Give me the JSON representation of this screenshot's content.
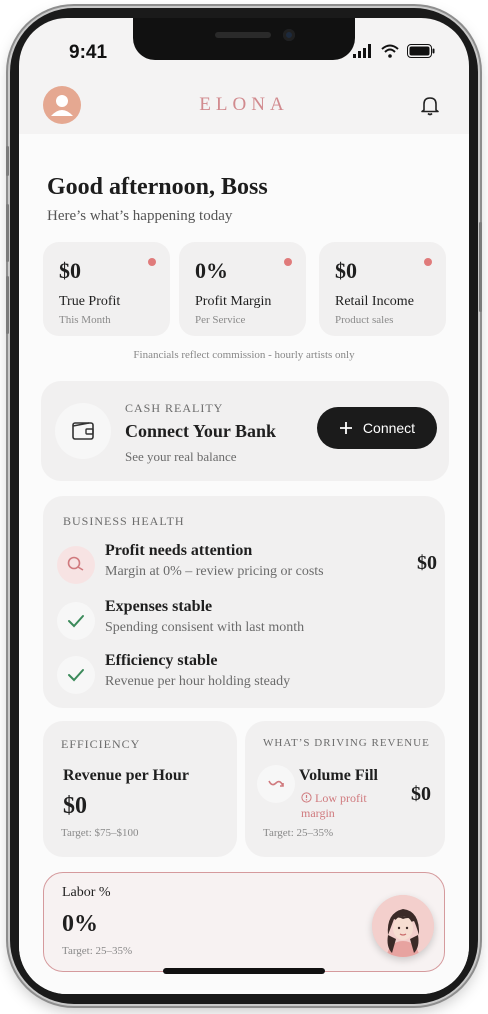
{
  "status_bar": {
    "time": "9:41"
  },
  "header": {
    "brand": "ELONA"
  },
  "greeting": {
    "title": "Good afternoon, Boss",
    "subtitle": "Here’s what’s happening today"
  },
  "stats": [
    {
      "value": "$0",
      "label": "True Profit",
      "sub": "This Month"
    },
    {
      "value": "0%",
      "label": "Profit Margin",
      "sub": "Per Service"
    },
    {
      "value": "$0",
      "label": "Retail Income",
      "sub": "Product sales"
    }
  ],
  "financials_note": "Financials reflect commission - hourly artists only",
  "cash": {
    "eyebrow": "CASH REALITY",
    "title": "Connect Your Bank",
    "subtitle": "See your real balance",
    "button_label": "Connect"
  },
  "health": {
    "eyebrow": "BUSINESS HEALTH",
    "items": [
      {
        "title": "Profit needs attention",
        "subtitle": "Margin at 0% – review pricing or costs",
        "value": "$0"
      },
      {
        "title": "Expenses stable",
        "subtitle": "Spending consisent with last month"
      },
      {
        "title": "Efficiency stable",
        "subtitle": "Revenue per hour holding steady"
      }
    ]
  },
  "efficiency": {
    "eyebrow": "EFFICIENCY",
    "title": "Revenue per Hour",
    "value": "$0",
    "target": "Target: $75–$100"
  },
  "driving": {
    "eyebrow": "WHAT’S DRIVING REVENUE",
    "title": "Volume Fill",
    "warning_line1": "Low profit",
    "warning_line2": "margin",
    "value": "$0",
    "target": "Target: 25–35%"
  },
  "labor": {
    "label": "Labor %",
    "value": "0%",
    "target": "Target: 25–35%"
  },
  "colors": {
    "brand": "#d18a8e",
    "accent_dot": "#e07b7b",
    "success": "#3b8a5a",
    "button": "#1b1b1b"
  }
}
